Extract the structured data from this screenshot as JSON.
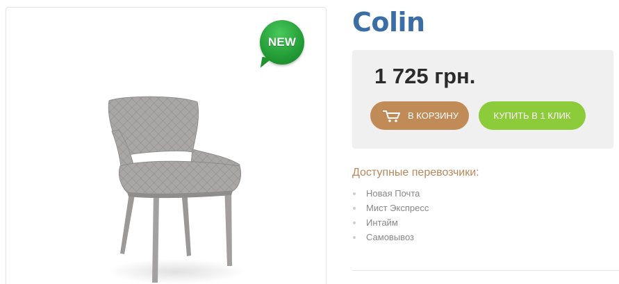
{
  "product": {
    "name": "Colin",
    "badge": "NEW",
    "price": "1 725 грн."
  },
  "actions": {
    "add_to_cart_label": "В КОРЗИНУ",
    "buy_one_click_label": "КУПИТЬ В 1 КЛИК"
  },
  "carriers": {
    "heading": "Доступные перевозчики:",
    "items": [
      "Новая Почта",
      "Мист Экспресс",
      "Интайм",
      "Самовывоз"
    ]
  },
  "colors": {
    "title": "#3b6ea5",
    "cart_button": "#c08b56",
    "buy_button": "#8ccc3a",
    "badge": "#239c36",
    "carriers_heading": "#b9875c"
  },
  "icons": [
    "cart-icon",
    "new-badge-icon",
    "product-image"
  ]
}
